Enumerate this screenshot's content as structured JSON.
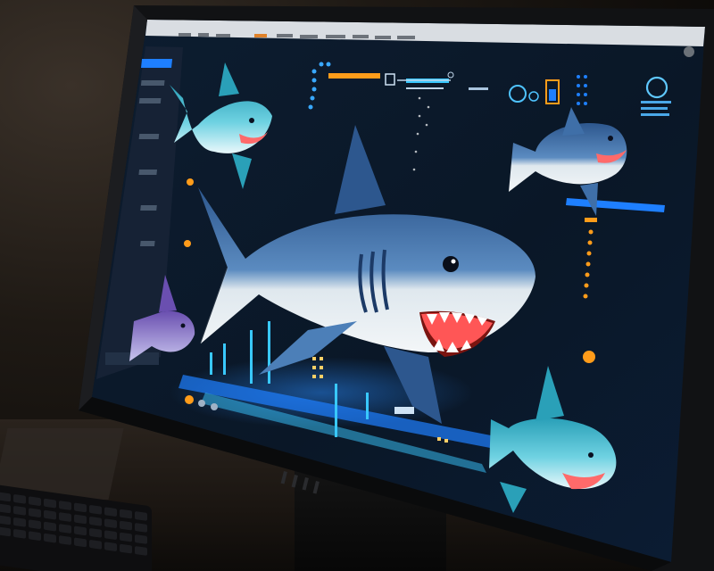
{
  "scene": {
    "description_free": true,
    "colors": {
      "screen_bg": "#0b1a2b",
      "accent_blue": "#1e7fff",
      "accent_cyan": "#39c8ff",
      "accent_orange": "#ff9c1a",
      "shark_blue": "#3f6fa8",
      "shark_belly": "#e9f0f4"
    }
  },
  "monitor": {
    "brand_label": "",
    "screen_title": ""
  },
  "hud": {
    "icons": [
      "gear-cluster-icon",
      "battery-icon",
      "brain-circuit-icon",
      "lock-icon"
    ]
  }
}
